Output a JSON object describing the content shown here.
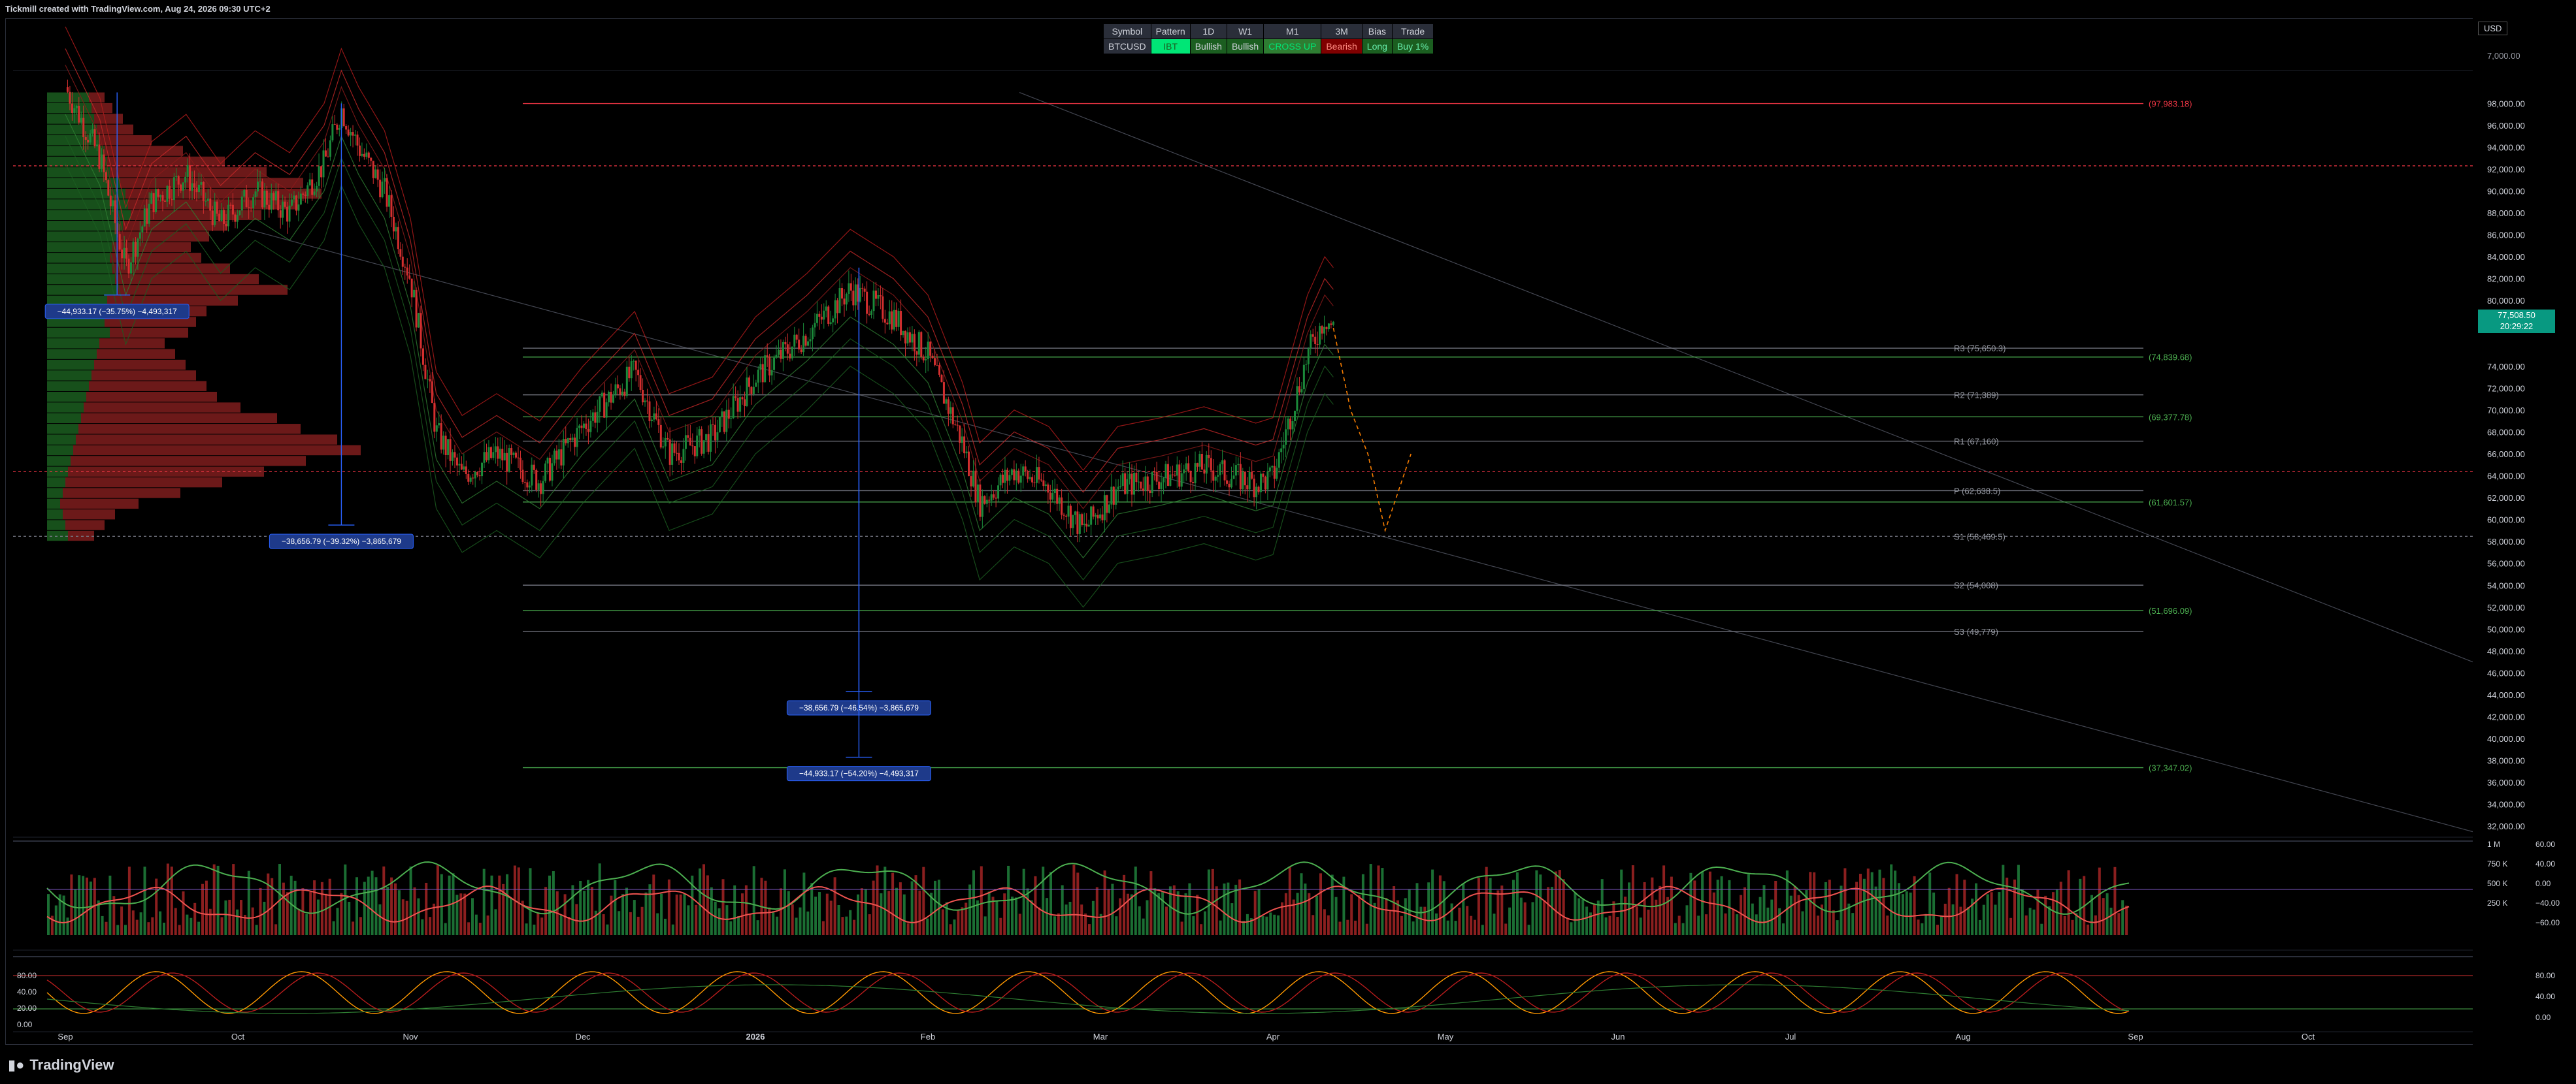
{
  "header": {
    "credit": "Tickmill created with TradingView.com, Aug 24, 2026 09:30 UTC+2",
    "currency": "USD"
  },
  "table": {
    "headers": [
      "Symbol",
      "Pattern",
      "1D",
      "W1",
      "M1",
      "3M",
      "Bias",
      "Trade"
    ],
    "values": [
      "BTCUSD",
      "IBT",
      "Bullish",
      "Bullish",
      "CROSS UP",
      "Bearish",
      "Long",
      "Buy 1%"
    ]
  },
  "price_tag": {
    "price": "77,508.50",
    "countdown": "20:29:22"
  },
  "footer": {
    "brand": "TradingView"
  },
  "colors": {
    "bull": "#1b8a3a",
    "bear": "#d32f2f",
    "pivot": "#787b86",
    "channel": "#b71c1c",
    "measure": "#2962ff"
  },
  "chart_data": [
    {
      "type": "line",
      "description_ref": "BTCUSD daily candlesticks with volume profile, pivots, Bollinger/Keltner envelopes",
      "x_ticks": [
        "Sep",
        "Oct",
        "Nov",
        "Dec",
        "2026",
        "Feb",
        "Mar",
        "Apr",
        "May",
        "Jun",
        "Jul",
        "Aug",
        "Sep",
        "Oct"
      ],
      "y_ticks": [
        "98,000.00",
        "96,000.00",
        "94,000.00",
        "92,000.00",
        "90,000.00",
        "88,000.00",
        "86,000.00",
        "84,000.00",
        "82,000.00",
        "80,000.00",
        "78,000.00",
        "74,000.00",
        "72,000.00",
        "70,000.00",
        "68,000.00",
        "66,000.00",
        "64,000.00",
        "62,000.00",
        "60,000.00",
        "58,000.00",
        "56,000.00",
        "54,000.00",
        "52,000.00",
        "50,000.00",
        "48,000.00",
        "46,000.00",
        "44,000.00",
        "42,000.00",
        "40,000.00",
        "38,000.00",
        "36,000.00",
        "34,000.00",
        "32,000.00"
      ],
      "y_top_tick": "7,000.00",
      "ylim": [
        31000,
        101000
      ],
      "price_path": [
        [
          0.0,
          99500
        ],
        [
          0.2,
          93000
        ],
        [
          0.35,
          83000
        ],
        [
          0.5,
          89000
        ],
        [
          0.7,
          91500
        ],
        [
          0.9,
          87000
        ],
        [
          1.1,
          90000
        ],
        [
          1.3,
          88000
        ],
        [
          1.5,
          92500
        ],
        [
          1.6,
          97500
        ],
        [
          1.7,
          94000
        ],
        [
          1.85,
          90000
        ],
        [
          2.0,
          82000
        ],
        [
          2.15,
          68000
        ],
        [
          2.3,
          64000
        ],
        [
          2.5,
          66000
        ],
        [
          2.75,
          63500
        ],
        [
          3.0,
          68500
        ],
        [
          3.3,
          73500
        ],
        [
          3.5,
          66000
        ],
        [
          3.75,
          67500
        ],
        [
          4.0,
          73000
        ],
        [
          4.3,
          77000
        ],
        [
          4.55,
          81000
        ],
        [
          4.65,
          80000
        ],
        [
          4.8,
          78500
        ],
        [
          5.0,
          75000
        ],
        [
          5.2,
          67000
        ],
        [
          5.3,
          61500
        ],
        [
          5.5,
          64500
        ],
        [
          5.7,
          63000
        ],
        [
          5.9,
          59000
        ],
        [
          6.1,
          63000
        ],
        [
          6.35,
          63800
        ],
        [
          6.6,
          64800
        ],
        [
          6.9,
          63300
        ],
        [
          7.0,
          63800
        ],
        [
          7.2,
          75000
        ],
        [
          7.3,
          78500
        ],
        [
          7.35,
          77508
        ]
      ],
      "profile_bull": [
        32,
        34,
        36,
        38,
        40,
        44,
        46,
        48,
        56,
        60,
        62,
        64,
        58,
        54,
        50,
        48,
        50,
        52,
        54,
        46,
        42,
        44,
        48,
        40,
        38,
        36,
        34,
        32,
        30,
        28,
        26,
        24,
        22,
        20,
        18,
        16,
        14,
        12,
        10,
        12,
        14,
        16
      ],
      "profile_bear": [
        12,
        16,
        22,
        28,
        40,
        60,
        90,
        120,
        140,
        150,
        130,
        100,
        80,
        70,
        60,
        70,
        90,
        110,
        130,
        100,
        80,
        70,
        60,
        50,
        60,
        70,
        80,
        90,
        100,
        120,
        150,
        170,
        200,
        220,
        180,
        150,
        120,
        90,
        60,
        40,
        30,
        20
      ],
      "h_levels": [
        {
          "label": "(97,983.18)",
          "price": 97983,
          "color": "#f23645",
          "style": "solid"
        },
        {
          "label": "",
          "price": 92300,
          "color": "#f23645",
          "style": "dotted"
        },
        {
          "label": "R3 (75,650.3)",
          "price": 75650,
          "color": "#787b86",
          "style": "solid"
        },
        {
          "label": "(74,839.68)",
          "price": 74840,
          "color": "#4caf50",
          "style": "solid"
        },
        {
          "label": "R2 (71,389)",
          "price": 71389,
          "color": "#787b86",
          "style": "solid"
        },
        {
          "label": "(69,377.78)",
          "price": 69378,
          "color": "#4caf50",
          "style": "solid"
        },
        {
          "label": "R1 (67,160)",
          "price": 67160,
          "color": "#787b86",
          "style": "solid"
        },
        {
          "label": "",
          "price": 64400,
          "color": "#f23645",
          "style": "dotted"
        },
        {
          "label": "P (62,638.5)",
          "price": 62639,
          "color": "#787b86",
          "style": "solid"
        },
        {
          "label": "(61,601.57)",
          "price": 61602,
          "color": "#4caf50",
          "style": "solid"
        },
        {
          "label": "S1 (58,469.5)",
          "price": 58470,
          "color": "#787b86",
          "style": "dotted"
        },
        {
          "label": "S2 (54,008)",
          "price": 54008,
          "color": "#787b86",
          "style": "solid"
        },
        {
          "label": "(51,696.09)",
          "price": 51696,
          "color": "#4caf50",
          "style": "solid"
        },
        {
          "label": "S3 (49,779)",
          "price": 49779,
          "color": "#787b86",
          "style": "solid"
        },
        {
          "label": "(37,347.02)",
          "price": 37347,
          "color": "#4caf50",
          "style": "solid"
        }
      ],
      "measures": [
        {
          "label": "−44,933.17 (−35.75%) −4,493,317",
          "x": 0.3,
          "from": 99000,
          "to": 80500
        },
        {
          "label": "−38,656.79 (−39.32%) −3,865,679",
          "x": 1.6,
          "from": 98000,
          "to": 59500
        },
        {
          "label": "−38,656.79 (−46.54%) −3,865,679",
          "x": 4.6,
          "from": 83000,
          "to": 44300
        },
        {
          "label": "−44,933.17 (−54.20%) −4,493,317",
          "x": 4.6,
          "from": 83000,
          "to": 38300
        }
      ],
      "projection": [
        [
          7.35,
          77508
        ],
        [
          7.45,
          70000
        ],
        [
          7.55,
          66000
        ],
        [
          7.65,
          59000
        ],
        [
          7.8,
          66000
        ]
      ]
    },
    {
      "type": "bar",
      "name_ref": "volume",
      "y_ticks": [
        "1 M",
        "750 K",
        "500 K",
        "250 K"
      ],
      "y_ticks_right": [
        "60.00",
        "40.00",
        "0.00",
        "−40.00",
        "−60.00"
      ]
    },
    {
      "type": "line",
      "name_ref": "stochastic",
      "y_ticks": [
        "80.00",
        "40.00",
        "20.00",
        "0.00"
      ],
      "y_ticks_right": [
        "80.00",
        "40.00",
        "0.00"
      ]
    }
  ]
}
